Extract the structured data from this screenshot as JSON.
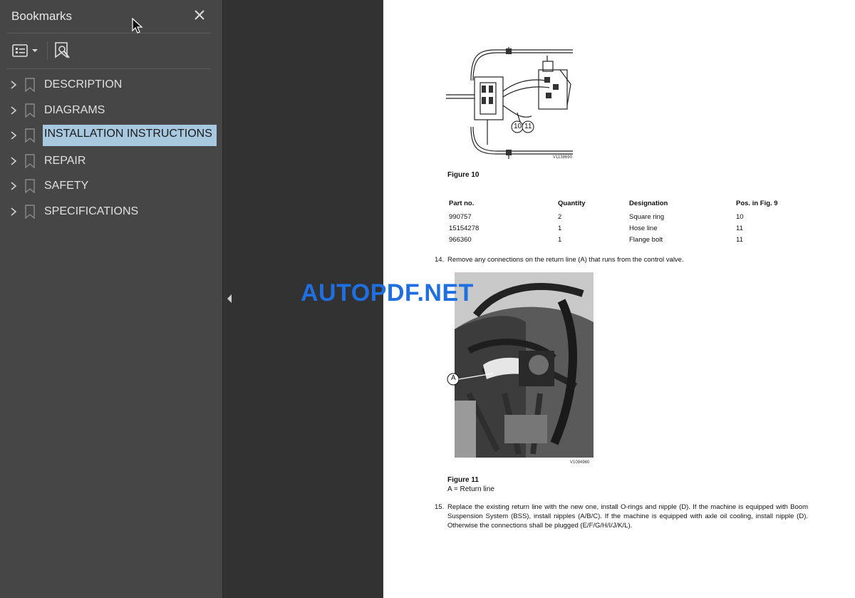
{
  "sidebar": {
    "title": "Bookmarks",
    "close_icon": "close-icon",
    "options_icon": "options-menu-icon",
    "find_bookmark_icon": "find-bookmark-icon",
    "items": [
      {
        "label": "DESCRIPTION",
        "selected": false
      },
      {
        "label": "DIAGRAMS",
        "selected": false
      },
      {
        "label": "INSTALLATION INSTRUCTIONS",
        "selected": true
      },
      {
        "label": "REPAIR",
        "selected": false
      },
      {
        "label": "SAFETY",
        "selected": false
      },
      {
        "label": "SPECIFICATIONS",
        "selected": false
      }
    ]
  },
  "colors": {
    "sidebar_bg": "#464646",
    "viewer_bg": "#323232",
    "selection": "#a8c8e0",
    "watermark": "#1f6fe0"
  },
  "page": {
    "figure10": {
      "caption": "Figure 10",
      "callout_a": "10",
      "callout_b": "11",
      "code": "V1138690"
    },
    "table": {
      "headers": [
        "Part no.",
        "Quantity",
        "Designation",
        "Pos. in Fig. 9"
      ],
      "rows": [
        [
          "990757",
          "2",
          "Square ring",
          "10"
        ],
        [
          "15154278",
          "1",
          "Hose line",
          "11"
        ],
        [
          "966360",
          "1",
          "Flange bolt",
          "11"
        ]
      ]
    },
    "step14": {
      "num": "14.",
      "text": "Remove any connections on the return line (A) that runs from the control valve."
    },
    "figure11": {
      "caption": "Figure 11",
      "legend": "A = Return line",
      "callout": "A",
      "code": "V1094960"
    },
    "step15": {
      "num": "15.",
      "text": "Replace the existing return line with the new one, install O-rings and nipple (D). If the machine is equipped with Boom Suspension System (BSS), install nipples (A/B/C). If the machine is equipped with axle oil cooling, install nipple (D). Otherwise the connections shall be plugged (E/F/G/H/I/J/K/L)."
    }
  },
  "watermark": "AUTOPDF.NET"
}
